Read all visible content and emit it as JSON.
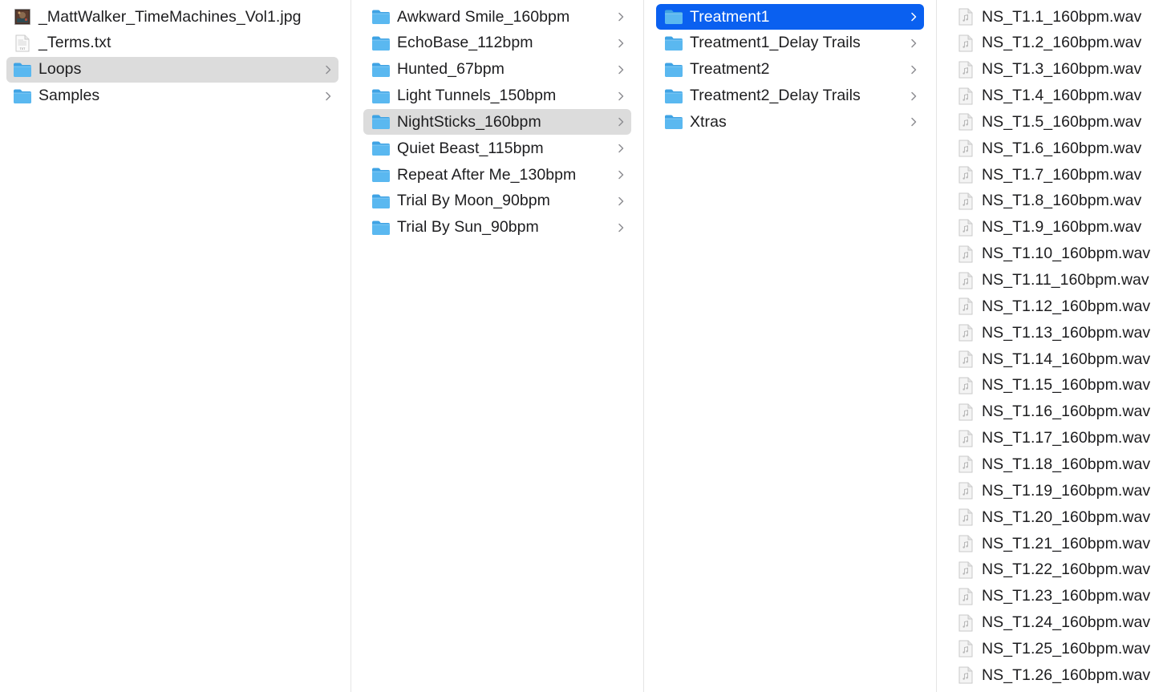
{
  "columns": [
    {
      "items": [
        {
          "label": "_MattWalker_TimeMachines_Vol1.jpg",
          "icon": "image-file-icon",
          "chevron": false,
          "selected": "none"
        },
        {
          "label": "_Terms.txt",
          "icon": "text-file-icon",
          "chevron": false,
          "selected": "none",
          "icon_text": "TXT"
        },
        {
          "label": "Loops",
          "icon": "folder-icon",
          "chevron": true,
          "selected": "inactive"
        },
        {
          "label": "Samples",
          "icon": "folder-icon",
          "chevron": true,
          "selected": "none"
        }
      ]
    },
    {
      "items": [
        {
          "label": "Awkward Smile_160bpm",
          "icon": "folder-icon",
          "chevron": true,
          "selected": "none"
        },
        {
          "label": "EchoBase_112bpm",
          "icon": "folder-icon",
          "chevron": true,
          "selected": "none"
        },
        {
          "label": "Hunted_67bpm",
          "icon": "folder-icon",
          "chevron": true,
          "selected": "none"
        },
        {
          "label": "Light Tunnels_150bpm",
          "icon": "folder-icon",
          "chevron": true,
          "selected": "none"
        },
        {
          "label": "NightSticks_160bpm",
          "icon": "folder-icon",
          "chevron": true,
          "selected": "inactive"
        },
        {
          "label": "Quiet Beast_115bpm",
          "icon": "folder-icon",
          "chevron": true,
          "selected": "none"
        },
        {
          "label": "Repeat After Me_130bpm",
          "icon": "folder-icon",
          "chevron": true,
          "selected": "none"
        },
        {
          "label": "Trial By Moon_90bpm",
          "icon": "folder-icon",
          "chevron": true,
          "selected": "none"
        },
        {
          "label": "Trial By Sun_90bpm",
          "icon": "folder-icon",
          "chevron": true,
          "selected": "none"
        }
      ]
    },
    {
      "items": [
        {
          "label": "Treatment1",
          "icon": "folder-icon",
          "chevron": true,
          "selected": "active"
        },
        {
          "label": "Treatment1_Delay Trails",
          "icon": "folder-icon",
          "chevron": true,
          "selected": "none"
        },
        {
          "label": "Treatment2",
          "icon": "folder-icon",
          "chevron": true,
          "selected": "none"
        },
        {
          "label": "Treatment2_Delay Trails",
          "icon": "folder-icon",
          "chevron": true,
          "selected": "none"
        },
        {
          "label": "Xtras",
          "icon": "folder-icon",
          "chevron": true,
          "selected": "none"
        }
      ]
    },
    {
      "items": [
        {
          "label": "NS_T1.1_160bpm.wav",
          "icon": "audio-file-icon",
          "chevron": false,
          "selected": "none"
        },
        {
          "label": "NS_T1.2_160bpm.wav",
          "icon": "audio-file-icon",
          "chevron": false,
          "selected": "none"
        },
        {
          "label": "NS_T1.3_160bpm.wav",
          "icon": "audio-file-icon",
          "chevron": false,
          "selected": "none"
        },
        {
          "label": "NS_T1.4_160bpm.wav",
          "icon": "audio-file-icon",
          "chevron": false,
          "selected": "none"
        },
        {
          "label": "NS_T1.5_160bpm.wav",
          "icon": "audio-file-icon",
          "chevron": false,
          "selected": "none"
        },
        {
          "label": "NS_T1.6_160bpm.wav",
          "icon": "audio-file-icon",
          "chevron": false,
          "selected": "none"
        },
        {
          "label": "NS_T1.7_160bpm.wav",
          "icon": "audio-file-icon",
          "chevron": false,
          "selected": "none"
        },
        {
          "label": "NS_T1.8_160bpm.wav",
          "icon": "audio-file-icon",
          "chevron": false,
          "selected": "none"
        },
        {
          "label": "NS_T1.9_160bpm.wav",
          "icon": "audio-file-icon",
          "chevron": false,
          "selected": "none"
        },
        {
          "label": "NS_T1.10_160bpm.wav",
          "icon": "audio-file-icon",
          "chevron": false,
          "selected": "none"
        },
        {
          "label": "NS_T1.11_160bpm.wav",
          "icon": "audio-file-icon",
          "chevron": false,
          "selected": "none"
        },
        {
          "label": "NS_T1.12_160bpm.wav",
          "icon": "audio-file-icon",
          "chevron": false,
          "selected": "none"
        },
        {
          "label": "NS_T1.13_160bpm.wav",
          "icon": "audio-file-icon",
          "chevron": false,
          "selected": "none"
        },
        {
          "label": "NS_T1.14_160bpm.wav",
          "icon": "audio-file-icon",
          "chevron": false,
          "selected": "none"
        },
        {
          "label": "NS_T1.15_160bpm.wav",
          "icon": "audio-file-icon",
          "chevron": false,
          "selected": "none"
        },
        {
          "label": "NS_T1.16_160bpm.wav",
          "icon": "audio-file-icon",
          "chevron": false,
          "selected": "none"
        },
        {
          "label": "NS_T1.17_160bpm.wav",
          "icon": "audio-file-icon",
          "chevron": false,
          "selected": "none"
        },
        {
          "label": "NS_T1.18_160bpm.wav",
          "icon": "audio-file-icon",
          "chevron": false,
          "selected": "none"
        },
        {
          "label": "NS_T1.19_160bpm.wav",
          "icon": "audio-file-icon",
          "chevron": false,
          "selected": "none"
        },
        {
          "label": "NS_T1.20_160bpm.wav",
          "icon": "audio-file-icon",
          "chevron": false,
          "selected": "none"
        },
        {
          "label": "NS_T1.21_160bpm.wav",
          "icon": "audio-file-icon",
          "chevron": false,
          "selected": "none"
        },
        {
          "label": "NS_T1.22_160bpm.wav",
          "icon": "audio-file-icon",
          "chevron": false,
          "selected": "none"
        },
        {
          "label": "NS_T1.23_160bpm.wav",
          "icon": "audio-file-icon",
          "chevron": false,
          "selected": "none"
        },
        {
          "label": "NS_T1.24_160bpm.wav",
          "icon": "audio-file-icon",
          "chevron": false,
          "selected": "none"
        },
        {
          "label": "NS_T1.25_160bpm.wav",
          "icon": "audio-file-icon",
          "chevron": false,
          "selected": "none"
        },
        {
          "label": "NS_T1.26_160bpm.wav",
          "icon": "audio-file-icon",
          "chevron": false,
          "selected": "none"
        }
      ]
    }
  ],
  "colors": {
    "selection_active": "#0a60f0",
    "selection_inactive": "#dcdcdc",
    "folder": "#5ab8f0",
    "text": "#1d1d1f",
    "chevron": "#8e8e93",
    "separator": "#e5e5e5"
  }
}
